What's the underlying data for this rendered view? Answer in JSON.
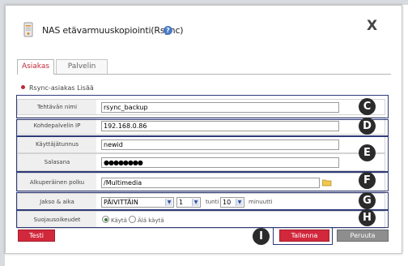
{
  "dialog": {
    "title": "NAS etävarmuuskopiointi(Rsync)",
    "close_label": "X"
  },
  "tabs": [
    {
      "label": "Asiakas",
      "active": true
    },
    {
      "label": "Palvelin",
      "active": false
    }
  ],
  "section_title": "Rsync-asiakas Lisää",
  "form": {
    "task_name": {
      "label": "Tehtävän nimi",
      "value": "rsync_backup"
    },
    "target_server": {
      "label": "Kohdepalvelin IP",
      "value": "192.168.0.86"
    },
    "username": {
      "label": "Käyttäjätunnus",
      "value": "newid"
    },
    "password": {
      "label": "Salasana",
      "value": "●●●●●●●●"
    },
    "source_path": {
      "label": "Alkuperäinen polku",
      "value": "/Multimedia"
    },
    "schedule": {
      "label": "Jakso & aika",
      "period": "PÄIVITTÄIN",
      "hour": "1",
      "hour_unit": "tunti",
      "minute": "10",
      "minute_unit": "minuutti"
    },
    "encryption": {
      "label": "Suojausoikeudet",
      "option_use": "Käytä",
      "option_not_use": "Älä käytä",
      "selected": "Käytä"
    }
  },
  "buttons": {
    "test": "Testi",
    "save": "Tallenna",
    "cancel": "Peruuta"
  },
  "callouts": [
    "C",
    "D",
    "E",
    "F",
    "G",
    "H",
    "I"
  ],
  "colors": {
    "accent_red": "#d2283c",
    "callout_bg": "#2b2b2b",
    "highlight_border": "#2f3a7a"
  }
}
